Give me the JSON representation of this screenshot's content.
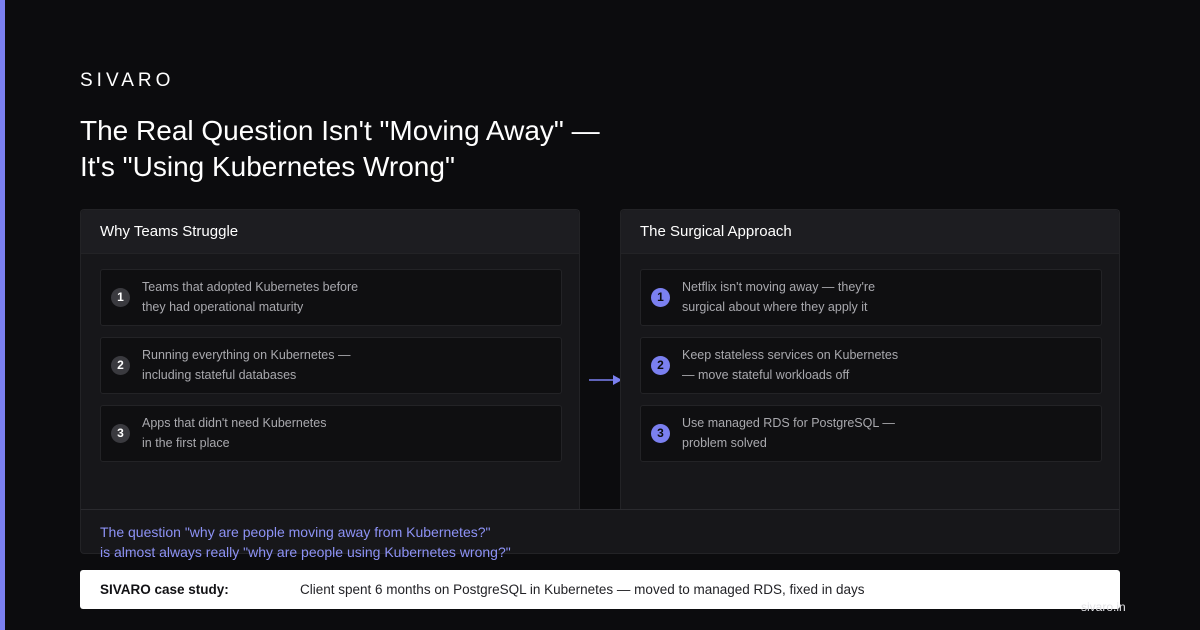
{
  "brand": "SIVARO",
  "title": "The Real Question Isn't \"Moving Away\" — It's \"Using Kubernetes Wrong\"",
  "panels": {
    "left": {
      "heading": "Why Teams Struggle",
      "items": [
        {
          "number": "1",
          "text": "Teams that adopted Kubernetes before\nthey had operational maturity"
        },
        {
          "number": "2",
          "text": "Running everything on Kubernetes —\nincluding stateful databases"
        },
        {
          "number": "3",
          "text": "Apps that didn't need Kubernetes\nin the first place"
        }
      ]
    },
    "right": {
      "heading": "The Surgical Approach",
      "items": [
        {
          "number": "1",
          "text": "Netflix isn't moving away — they're\nsurgical about where they apply it"
        },
        {
          "number": "2",
          "text": "Keep stateless services on Kubernetes\n— move stateful workloads off"
        },
        {
          "number": "3",
          "text": "Use managed RDS for PostgreSQL —\nproblem solved"
        }
      ]
    }
  },
  "question": "The question \"why are people moving away from Kubernetes?\"\nis almost always really \"why are people using Kubernetes wrong?\"",
  "case_study": {
    "label": "SIVARO case study:",
    "text": "Client spent 6 months on PostgreSQL in Kubernetes — moved to managed RDS, fixed in days"
  },
  "watermark": "sivaro.in",
  "colors": {
    "accent": "#7b80f0",
    "background": "#0c0c0e",
    "panel": "#17171a",
    "question_text": "#8d92f5"
  },
  "icons": {
    "arrow": "arrow-right-icon"
  }
}
